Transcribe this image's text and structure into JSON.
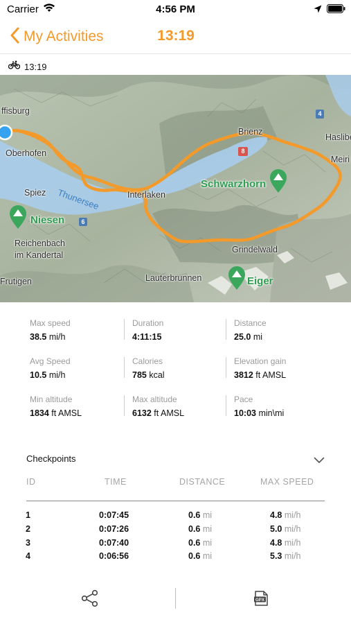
{
  "status_bar": {
    "carrier": "Carrier",
    "time": "4:56 PM",
    "icons": [
      "wifi-icon",
      "location-arrow-icon",
      "battery-icon"
    ]
  },
  "nav": {
    "back_label": "My Activities",
    "title": "13:19",
    "accent_color": "#f39a2b"
  },
  "activity": {
    "icon": "bicycle-icon",
    "time": "13:19"
  },
  "map": {
    "labels": {
      "ffisburg": "ffisburg",
      "oberhofen": "Oberhofen",
      "spiez": "Spiez",
      "thunersee": "Thunersee",
      "niesen": "Niesen",
      "reichenbach": "Reichenbach",
      "im_kandertal": "im Kandertal",
      "frutigen": "Frutigen",
      "interlaken": "Interlaken",
      "brienz": "Brienz",
      "schwarzhorn": "Schwarzhorn",
      "grindelwald": "Grindelwald",
      "lauterbrunnen": "Lauterbrunnen",
      "eiger": "Eiger",
      "haslib": "Haslibe",
      "meiri": "Meiri"
    },
    "road_shields": [
      "8",
      "6",
      "4"
    ],
    "route_color": "#f39a2b"
  },
  "stats": [
    {
      "label": "Max speed",
      "value": "38.5",
      "unit": "mi/h"
    },
    {
      "label": "Duration",
      "value": "4:11:15",
      "unit": ""
    },
    {
      "label": "Distance",
      "value": "25.0",
      "unit": "mi"
    },
    {
      "label": "Avg Speed",
      "value": "10.5",
      "unit": "mi/h"
    },
    {
      "label": "Calories",
      "value": "785",
      "unit": "kcal"
    },
    {
      "label": "Elevation gain",
      "value": "3812",
      "unit": "ft AMSL"
    },
    {
      "label": "Min altitude",
      "value": "1834",
      "unit": "ft AMSL"
    },
    {
      "label": "Max altitude",
      "value": "6132",
      "unit": "ft AMSL"
    },
    {
      "label": "Pace",
      "value": "10:03",
      "unit": "min\\mi"
    }
  ],
  "checkpoints": {
    "title": "Checkpoints",
    "columns": [
      "ID",
      "TIME",
      "DISTANCE",
      "MAX SPEED"
    ],
    "rows": [
      {
        "id": "1",
        "time": "0:07:45",
        "distance": "0.6",
        "distance_unit": "mi",
        "max_speed": "4.8",
        "speed_unit": "mi/h"
      },
      {
        "id": "2",
        "time": "0:07:26",
        "distance": "0.6",
        "distance_unit": "mi",
        "max_speed": "5.0",
        "speed_unit": "mi/h"
      },
      {
        "id": "3",
        "time": "0:07:40",
        "distance": "0.6",
        "distance_unit": "mi",
        "max_speed": "4.8",
        "speed_unit": "mi/h"
      },
      {
        "id": "4",
        "time": "0:06:56",
        "distance": "0.6",
        "distance_unit": "mi",
        "max_speed": "5.3",
        "speed_unit": "mi/h"
      }
    ]
  },
  "toolbar": {
    "share_icon": "share-icon",
    "gpx_label": "GPX"
  }
}
